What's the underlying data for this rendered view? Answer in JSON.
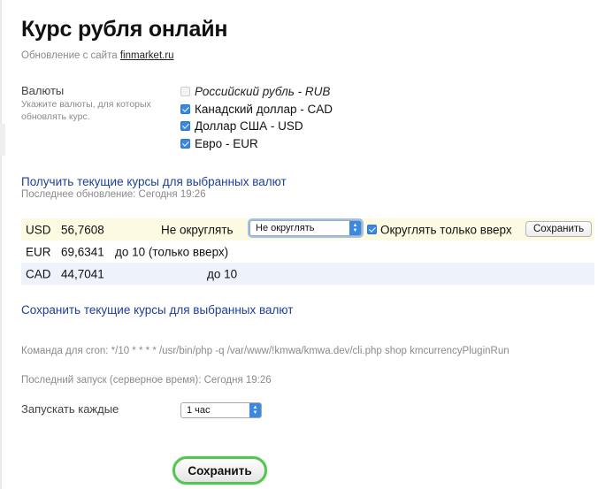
{
  "header": {
    "title": "Курс рубля онлайн",
    "subtitle_prefix": "Обновление с сайта ",
    "subtitle_link": "finmarket.ru"
  },
  "currencies": {
    "label": "Валюты",
    "hint": "Укажите валюты, для которых обновлять курс.",
    "items": [
      {
        "label": "Российский рубль - RUB",
        "checked": false,
        "disabled": true
      },
      {
        "label": "Канадский доллар - CAD",
        "checked": true
      },
      {
        "label": "Доллар США - USD",
        "checked": true
      },
      {
        "label": "Евро - EUR",
        "checked": true
      }
    ]
  },
  "actions": {
    "get_rates_link": "Получить текущие курсы для выбранных валют",
    "last_update": "Последнее обновление: Сегодня 19:26",
    "save_rates_link": "Сохранить текущие курсы для выбранных валют"
  },
  "rates": [
    {
      "code": "USD",
      "value": "56,7608",
      "rounding_label": "Не округлять",
      "select_value": "Не округлять",
      "round_up_label": "Округлять только вверх",
      "round_up_checked": true,
      "save_label": "Сохранить"
    },
    {
      "code": "EUR",
      "value": "69,6341",
      "note": "до 10  (только вверх)"
    },
    {
      "code": "CAD",
      "value": "44,7041",
      "note": "до 10"
    }
  ],
  "cron": {
    "command": "Команда для cron: */10 * * * * /usr/bin/php -q /var/www/!kmwa/kmwa.dev/cli.php shop kmcurrencyPluginRun",
    "last_run": "Последний запуск (серверное время): Сегодня 19:26"
  },
  "schedule": {
    "label": "Запускать каждые",
    "value": "1 час"
  },
  "footer": {
    "save_label": "Сохранить"
  },
  "colors": {
    "link": "#1c3f9a",
    "accent_blue": "#3a88e0",
    "save_border": "#55c455"
  }
}
